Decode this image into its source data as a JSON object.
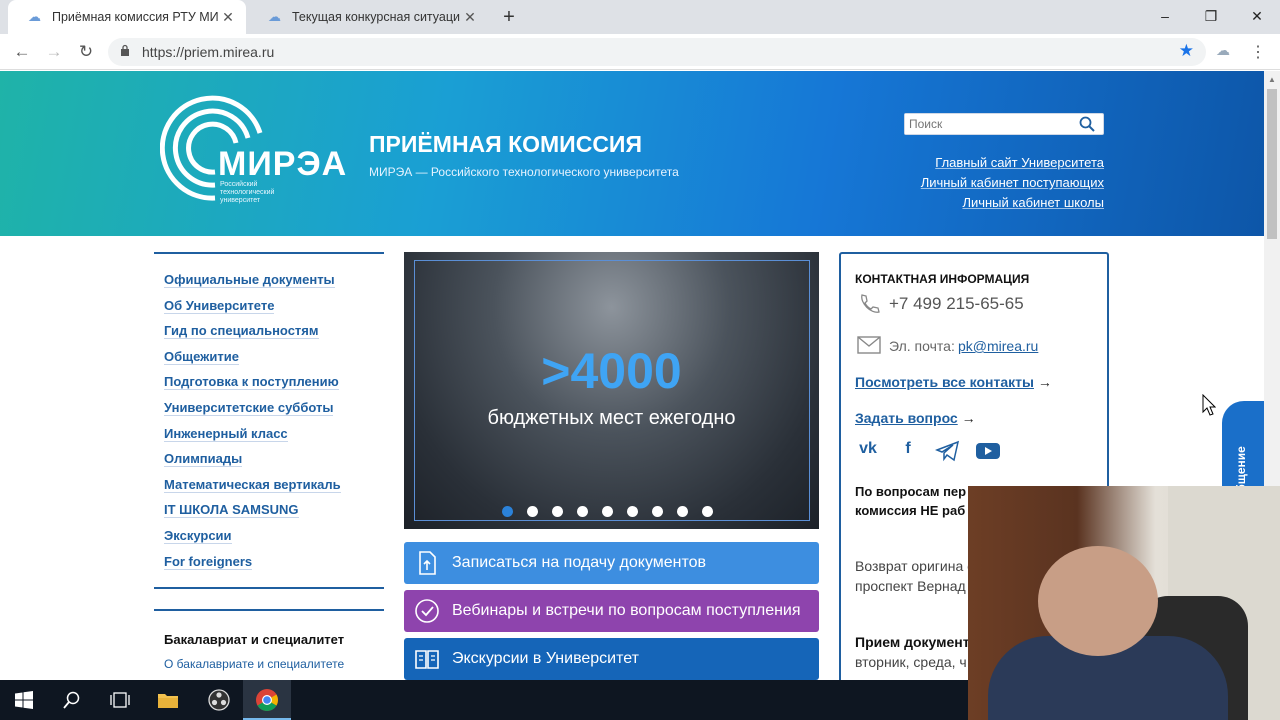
{
  "browser": {
    "tabs": [
      {
        "title": "Приёмная комиссия РТУ МИРЭА",
        "active": true
      },
      {
        "title": "Текущая конкурсная ситуация",
        "active": false
      }
    ],
    "new_tab": "+",
    "url": "https://priem.mirea.ru",
    "window_controls": {
      "minimize": "–",
      "maximize": "❐",
      "close": "✕"
    }
  },
  "header": {
    "logo_text": "МИРЭА",
    "logo_subtitle": "Российский технологический университет",
    "title": "ПРИЁМНАЯ КОМИССИЯ",
    "subtitle": "МИРЭА — Российского технологического университета",
    "search_placeholder": "Поиск",
    "links": [
      "Главный сайт Университета",
      "Личный кабинет поступающих",
      "Личный кабинет школы"
    ]
  },
  "left_menu": {
    "items": [
      "Официальные документы",
      "Об Университете",
      "Гид по специальностям",
      "Общежитие",
      "Подготовка к поступлению",
      "Университетские субботы",
      "Инженерный класс",
      "Олимпиады",
      "Математическая вертикаль",
      "IT ШКОЛА SAMSUNG",
      "Экскурсии",
      "For foreigners"
    ],
    "section_heading": "Бакалавриат и специалитет",
    "section_link": "О бакалавриате и специалитете"
  },
  "slider": {
    "big_text": ">4000",
    "text": "бюджетных мест ежегодно",
    "dot_count": 9,
    "active_dot": 0
  },
  "actions": [
    {
      "label": "Записаться на подачу документов",
      "color": "#3d8ee0"
    },
    {
      "label": "Вебинары и встречи по вопросам поступления",
      "color": "#8e44ad"
    },
    {
      "label": "Экскурсии в Университет",
      "color": "#1565b8"
    }
  ],
  "contact": {
    "heading": "КОНТАКТНАЯ ИНФОРМАЦИЯ",
    "phone": "+7 499 215-65-65",
    "email_label": "Эл. почта:",
    "email": "pk@mirea.ru",
    "all_contacts": "Посмотреть все контакты",
    "ask": "Задать вопрос",
    "arrow": "→",
    "socials": [
      "vk",
      "f",
      "telegram",
      "youtube"
    ],
    "question_text": "По вопросам пер и восстановлени комиссия НЕ раб",
    "return_text": "Возврат оригина осуществляется т проспект Вернад",
    "reception_title": "Прием документ",
    "reception_days": "вторник, среда, ч и пятница с 10:0"
  },
  "feedback_tab": "Общение",
  "taskbar": {
    "items": [
      "windows-start",
      "search",
      "task-view",
      "file-explorer",
      "obs",
      "chrome"
    ]
  }
}
